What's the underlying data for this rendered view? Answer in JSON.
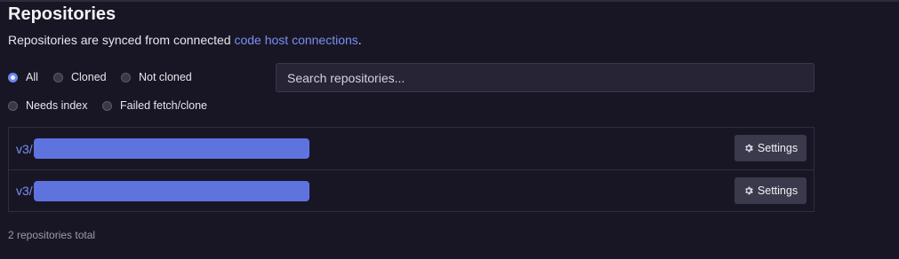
{
  "page": {
    "title": "Repositories",
    "subtitle_text": "Repositories are synced from connected ",
    "subtitle_link": "code host connections",
    "subtitle_end": "."
  },
  "filters": {
    "all": {
      "label": "All",
      "checked": true
    },
    "cloned": {
      "label": "Cloned",
      "checked": false
    },
    "not_cloned": {
      "label": "Not cloned",
      "checked": false
    },
    "needs_index": {
      "label": "Needs index",
      "checked": false
    },
    "failed_fetch": {
      "label": "Failed fetch/clone",
      "checked": false
    }
  },
  "search": {
    "placeholder": "Search repositories...",
    "value": ""
  },
  "repositories": [
    {
      "prefix": "v3/",
      "settings_label": "Settings"
    },
    {
      "prefix": "v3/",
      "settings_label": "Settings"
    }
  ],
  "footer": {
    "total": "2 repositories total"
  },
  "icons": {
    "settings": "gear-icon"
  },
  "colors": {
    "background": "#181624",
    "accent": "#7b8ff2",
    "redaction": "#5f73df",
    "button_bg": "#3b3a4c"
  }
}
